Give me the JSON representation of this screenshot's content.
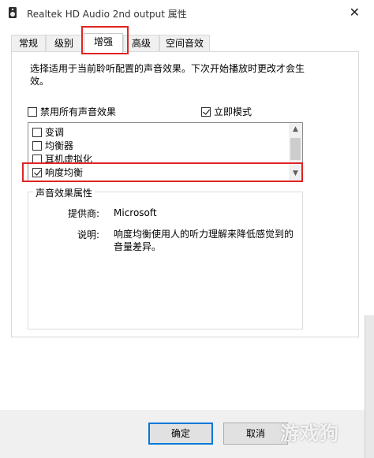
{
  "window": {
    "title": "Realtek HD Audio 2nd output 属性",
    "close_glyph": "✕"
  },
  "tabs": [
    {
      "label": "常规"
    },
    {
      "label": "级别"
    },
    {
      "label": "增强"
    },
    {
      "label": "高级"
    },
    {
      "label": "空间音效"
    }
  ],
  "active_tab": "增强",
  "enhancements": {
    "description": "选择适用于当前聆听配置的声音效果。下次开始播放时更改才会生效。",
    "disable_all_label": "禁用所有声音效果",
    "disable_all_checked": false,
    "immediate_mode_label": "立即模式",
    "immediate_mode_checked": true,
    "items": [
      {
        "label": "变调",
        "checked": false
      },
      {
        "label": "均衡器",
        "checked": false
      },
      {
        "label": "耳机虚拟化",
        "checked": false
      },
      {
        "label": "响度均衡",
        "checked": true
      }
    ],
    "properties": {
      "group_title": "声音效果属性",
      "provider_label": "提供商:",
      "provider_value": "Microsoft",
      "description_label": "说明:",
      "description_value": "响度均衡使用人的听力理解来降低感觉到的音量差异。"
    }
  },
  "buttons": {
    "ok": "确定",
    "cancel": "取消"
  },
  "watermark": "游戏狗"
}
